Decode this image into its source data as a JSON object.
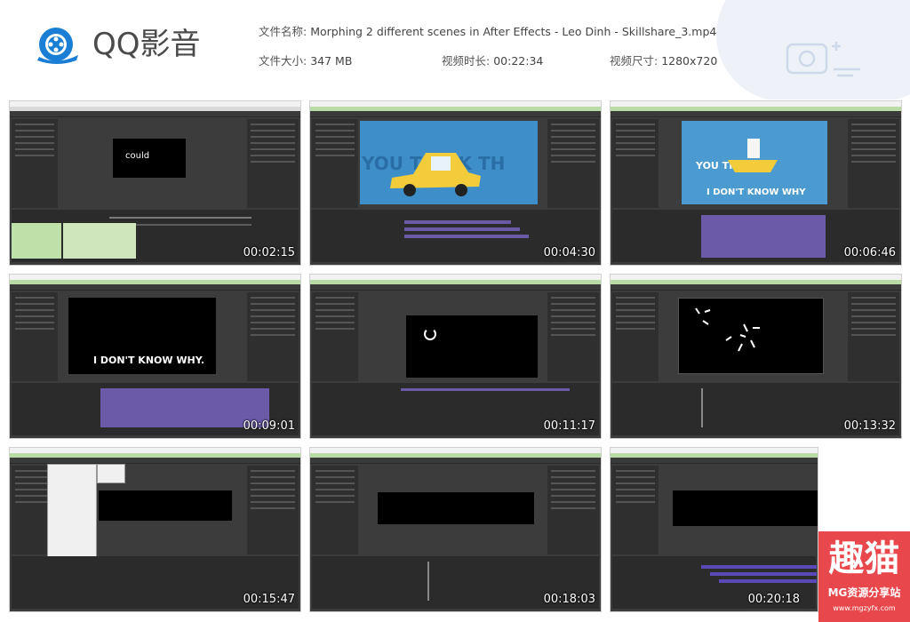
{
  "header": {
    "app_name": "QQ影音",
    "file_name_label": "文件名称:",
    "file_name": "Morphing 2 different scenes in After Effects - Leo Dinh - Skillshare_3.mp4",
    "file_size_label": "文件大小:",
    "file_size": "347 MB",
    "duration_label": "视频时长:",
    "duration": "00:22:34",
    "resolution_label": "视频尺寸:",
    "resolution": "1280x720"
  },
  "thumbnails": [
    {
      "timecode": "00:02:15",
      "overlay": "could"
    },
    {
      "timecode": "00:04:30",
      "overlay": "YOU THINK TH"
    },
    {
      "timecode": "00:06:46",
      "overlay": "I DON'T KNOW WHY",
      "overlay2": "YOU THAT"
    },
    {
      "timecode": "00:09:01",
      "overlay": "I DON'T KNOW WHY."
    },
    {
      "timecode": "00:11:17",
      "overlay": ""
    },
    {
      "timecode": "00:13:32",
      "overlay": ""
    },
    {
      "timecode": "00:15:47",
      "overlay": ""
    },
    {
      "timecode": "00:18:03",
      "overlay": ""
    },
    {
      "timecode": "00:20:18",
      "overlay": ""
    }
  ],
  "watermark": {
    "big": "趣猫",
    "sub": "MG资源分享站",
    "url": "www.mgzyfx.com"
  },
  "colors": {
    "brand_blue": "#1a7fd4",
    "watermark_red": "#e8474c",
    "scene_blue": "#3e8fc9",
    "taxi_yellow": "#f2cc3a",
    "timeline_purple": "#6b5aa8"
  }
}
